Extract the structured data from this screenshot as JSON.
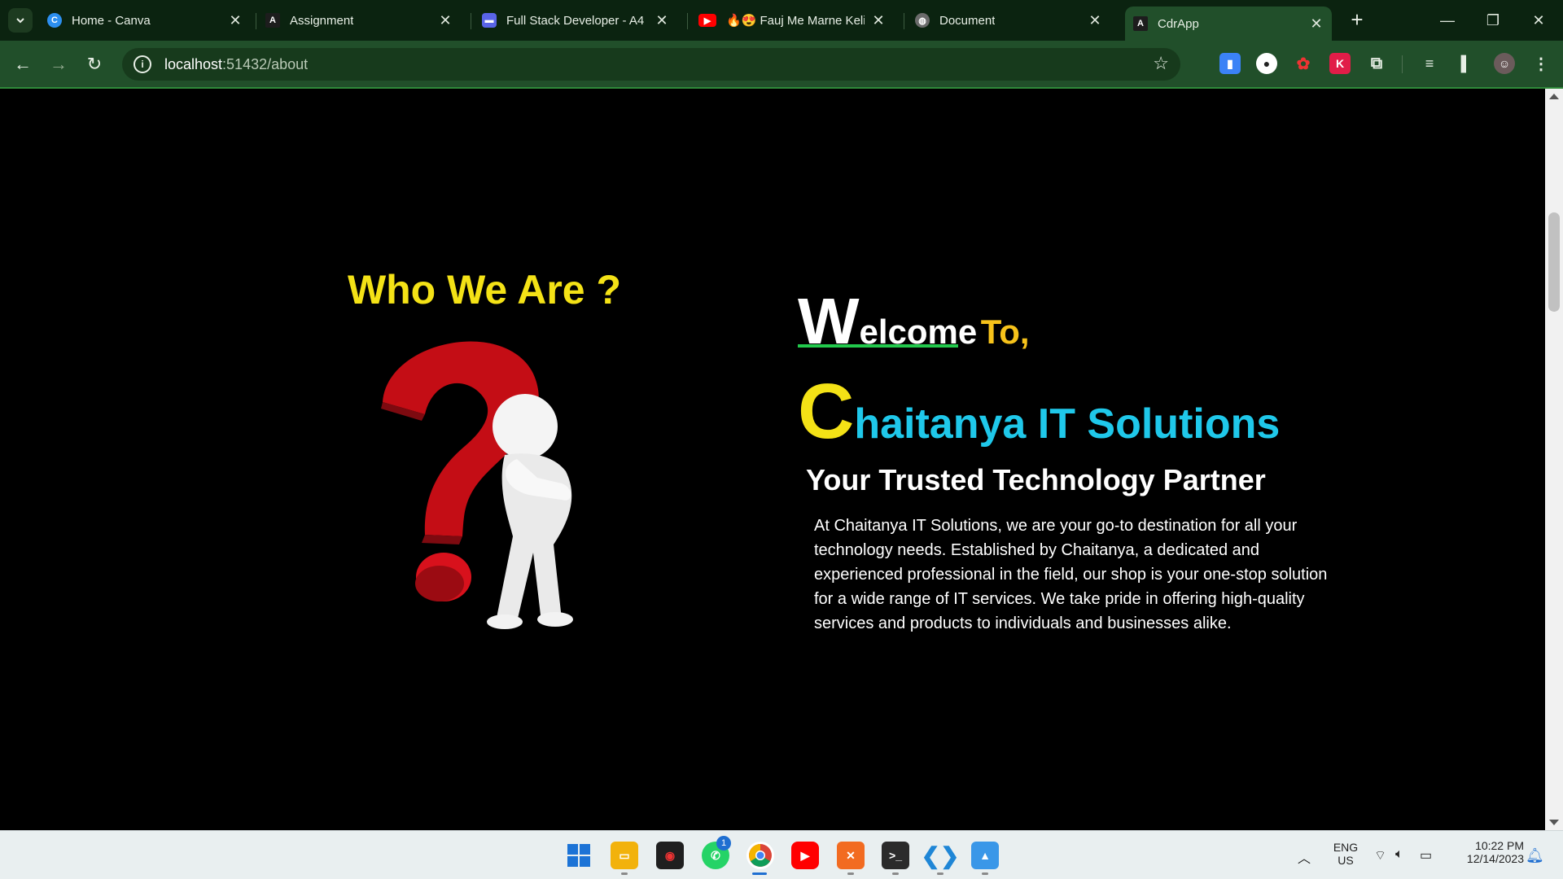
{
  "browser": {
    "tabs": [
      {
        "title": "Home - Canva",
        "icon": "canva-icon",
        "color": "#2c8ff0"
      },
      {
        "title": "Assignment",
        "icon": "angular-icon",
        "color": "#1d1d1d"
      },
      {
        "title": "Full Stack Developer - A4",
        "icon": "doc-icon",
        "color": "#5964e8"
      },
      {
        "title": "🔥😍 Fauj Me Marne Keliy",
        "icon": "youtube-icon",
        "color": "#ff0000"
      },
      {
        "title": "Document",
        "icon": "globe-icon",
        "color": "#6b6b6b"
      },
      {
        "title": "CdrApp",
        "icon": "angular-icon",
        "color": "#1d1d1d"
      }
    ],
    "active_tab": "CdrApp",
    "address": {
      "host": "localhost",
      "path": ":51432/about"
    }
  },
  "page": {
    "who_title": "Who We Are ?",
    "welcome": {
      "first_letter": "W",
      "rest": "elcome",
      "to": "To,"
    },
    "brand": {
      "first_letter": "C",
      "rest": "haitanya IT Solutions"
    },
    "tagline": "Your Trusted Technology Partner",
    "about": "At Chaitanya IT Solutions, we are your go-to destination for all your technology needs. Established by Chaitanya, a dedicated and experienced professional in the field, our shop is your one-stop solution for a wide range of IT services. We take pride in offering high-quality services and products to individuals and businesses alike."
  },
  "taskbar": {
    "whatsapp_badge": "1",
    "language": {
      "line1": "ENG",
      "line2": "US"
    },
    "clock": {
      "time": "10:22 PM",
      "date": "12/14/2023"
    }
  },
  "colors": {
    "frame": "#0b2310",
    "toolbar": "#214f2a",
    "heading_yellow": "#f4e216",
    "brand_cyan": "#1fc8ea",
    "underline_green": "#22c94c"
  }
}
